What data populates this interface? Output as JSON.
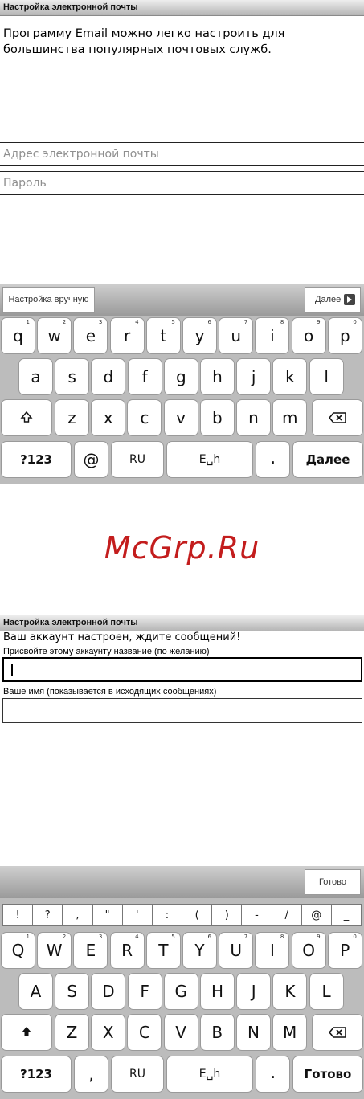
{
  "screen1": {
    "title": "Настройка электронной почты",
    "intro": "Программу Email можно легко настроить для большинства популярных почтовых служб.",
    "email_placeholder": "Адрес электронной почты",
    "password_placeholder": "Пароль",
    "manual_button": "Настройка вручную",
    "next_button": "Далее",
    "keyboard": {
      "row1": [
        [
          "q",
          "1"
        ],
        [
          "w",
          "2"
        ],
        [
          "e",
          "3"
        ],
        [
          "r",
          "4"
        ],
        [
          "t",
          "5"
        ],
        [
          "y",
          "6"
        ],
        [
          "u",
          "7"
        ],
        [
          "i",
          "8"
        ],
        [
          "o",
          "9"
        ],
        [
          "p",
          "0"
        ]
      ],
      "row2": [
        "a",
        "s",
        "d",
        "f",
        "g",
        "h",
        "j",
        "k",
        "l"
      ],
      "row3": [
        "z",
        "x",
        "c",
        "v",
        "b",
        "n",
        "m"
      ],
      "sym_key": "?123",
      "at_key": "@",
      "lang_key": "RU",
      "space_label": "E␣h",
      "dot_key": ".",
      "enter_key": "Далее"
    }
  },
  "watermark": "McGrp.Ru",
  "screen2": {
    "title": "Настройка электронной почты",
    "message": "Ваш аккаунт настроен, ждите сообщений!",
    "account_name_label": "Присвойте этому аккаунту название (по желанию)",
    "your_name_label": "Ваше имя (показывается в исходящих сообщениях)",
    "done_button": "Готово",
    "symbols": [
      "!",
      "?",
      ",",
      "\"",
      "'",
      ":",
      "(",
      ")",
      "-",
      "/",
      "@",
      "_"
    ],
    "keyboard": {
      "row1": [
        [
          "Q",
          "1"
        ],
        [
          "W",
          "2"
        ],
        [
          "E",
          "3"
        ],
        [
          "R",
          "4"
        ],
        [
          "T",
          "5"
        ],
        [
          "Y",
          "6"
        ],
        [
          "U",
          "7"
        ],
        [
          "I",
          "8"
        ],
        [
          "O",
          "9"
        ],
        [
          "P",
          "0"
        ]
      ],
      "row2": [
        "A",
        "S",
        "D",
        "F",
        "G",
        "H",
        "J",
        "K",
        "L"
      ],
      "row3": [
        "Z",
        "X",
        "C",
        "V",
        "B",
        "N",
        "M"
      ],
      "sym_key": "?123",
      "comma_key": ",",
      "lang_key": "RU",
      "space_label": "E␣h",
      "dot_key": ".",
      "enter_key": "Готово"
    }
  },
  "colors": {
    "watermark": "#c31d1d",
    "keyboard_bg": "#bcbcbc",
    "actionbar": "#a8a8a8"
  }
}
